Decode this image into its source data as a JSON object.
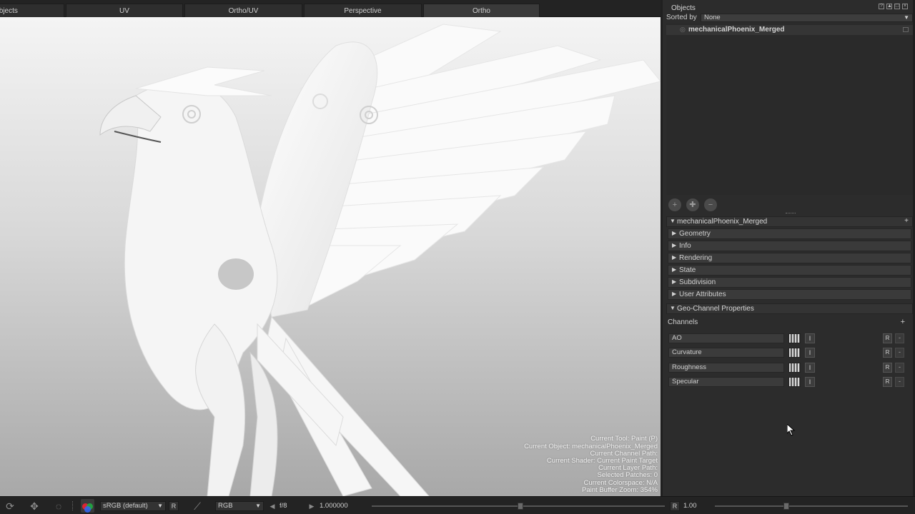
{
  "tabs": [
    {
      "label": "Objects"
    },
    {
      "label": "UV"
    },
    {
      "label": "Ortho/UV"
    },
    {
      "label": "Perspective"
    },
    {
      "label": "Ortho"
    }
  ],
  "hud": {
    "current_tool": "Current Tool: Paint (P)",
    "current_object": "Current Object: mechanicalPhoenix_Merged",
    "current_channel_path": "Current Channel Path:",
    "current_shader": "Current Shader: Current Paint Target",
    "current_layer_path": "Current Layer Path:",
    "selected_patches": "Selected Patches: 0",
    "current_colorspace": "Current Colorspace: N/A",
    "paint_buffer_zoom": "Paint Buffer Zoom: 354%"
  },
  "objects_panel": {
    "title": "Objects",
    "sorted_by_label": "Sorted by",
    "sorted_by_value": "None",
    "items": [
      {
        "name": "mechanicalPhoenix_Merged"
      }
    ]
  },
  "properties": {
    "object_name": "mechanicalPhoenix_Merged",
    "sections": [
      {
        "label": "Geometry"
      },
      {
        "label": "Info"
      },
      {
        "label": "Rendering"
      },
      {
        "label": "State"
      },
      {
        "label": "Subdivision"
      },
      {
        "label": "User Attributes"
      }
    ],
    "geo_channel_title": "Geo-Channel Properties",
    "channels_label": "Channels",
    "channels": [
      {
        "name": "AO",
        "i": "I",
        "r": "R",
        "m": "-"
      },
      {
        "name": "Curvature",
        "i": "I",
        "r": "R",
        "m": "-"
      },
      {
        "name": "Roughness",
        "i": "I",
        "r": "R",
        "m": "-"
      },
      {
        "name": "Specular",
        "i": "I",
        "r": "R",
        "m": "-"
      }
    ]
  },
  "bottom_bar": {
    "colorspace": "sRGB (default)",
    "r_button": "R",
    "channel_mode": "RGB",
    "fstop": "f/8",
    "exposure": "1.000000",
    "r_button2": "R",
    "gamma": "1.00"
  }
}
